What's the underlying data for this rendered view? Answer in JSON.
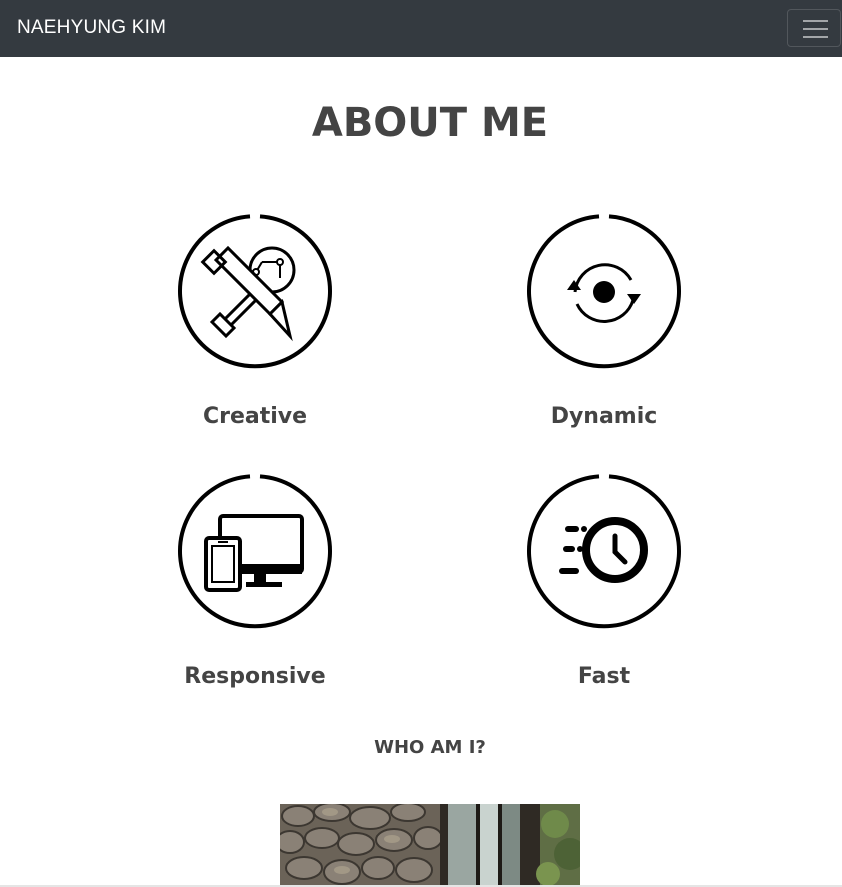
{
  "navbar": {
    "brand": "NAEHYUNG KIM",
    "menu_icon": "hamburger-icon"
  },
  "about": {
    "title": "ABOUT ME",
    "features": [
      {
        "label": "Creative",
        "icon": "pencil-lightbulb-icon"
      },
      {
        "label": "Dynamic",
        "icon": "refresh-cycle-icon"
      },
      {
        "label": "Responsive",
        "icon": "devices-icon"
      },
      {
        "label": "Fast",
        "icon": "fast-clock-icon"
      }
    ]
  },
  "who": {
    "title": "WHO AM I?",
    "photo": "profile-photo"
  },
  "colors": {
    "navbar_bg": "#343a40",
    "text": "#444444",
    "icon": "#000000"
  }
}
